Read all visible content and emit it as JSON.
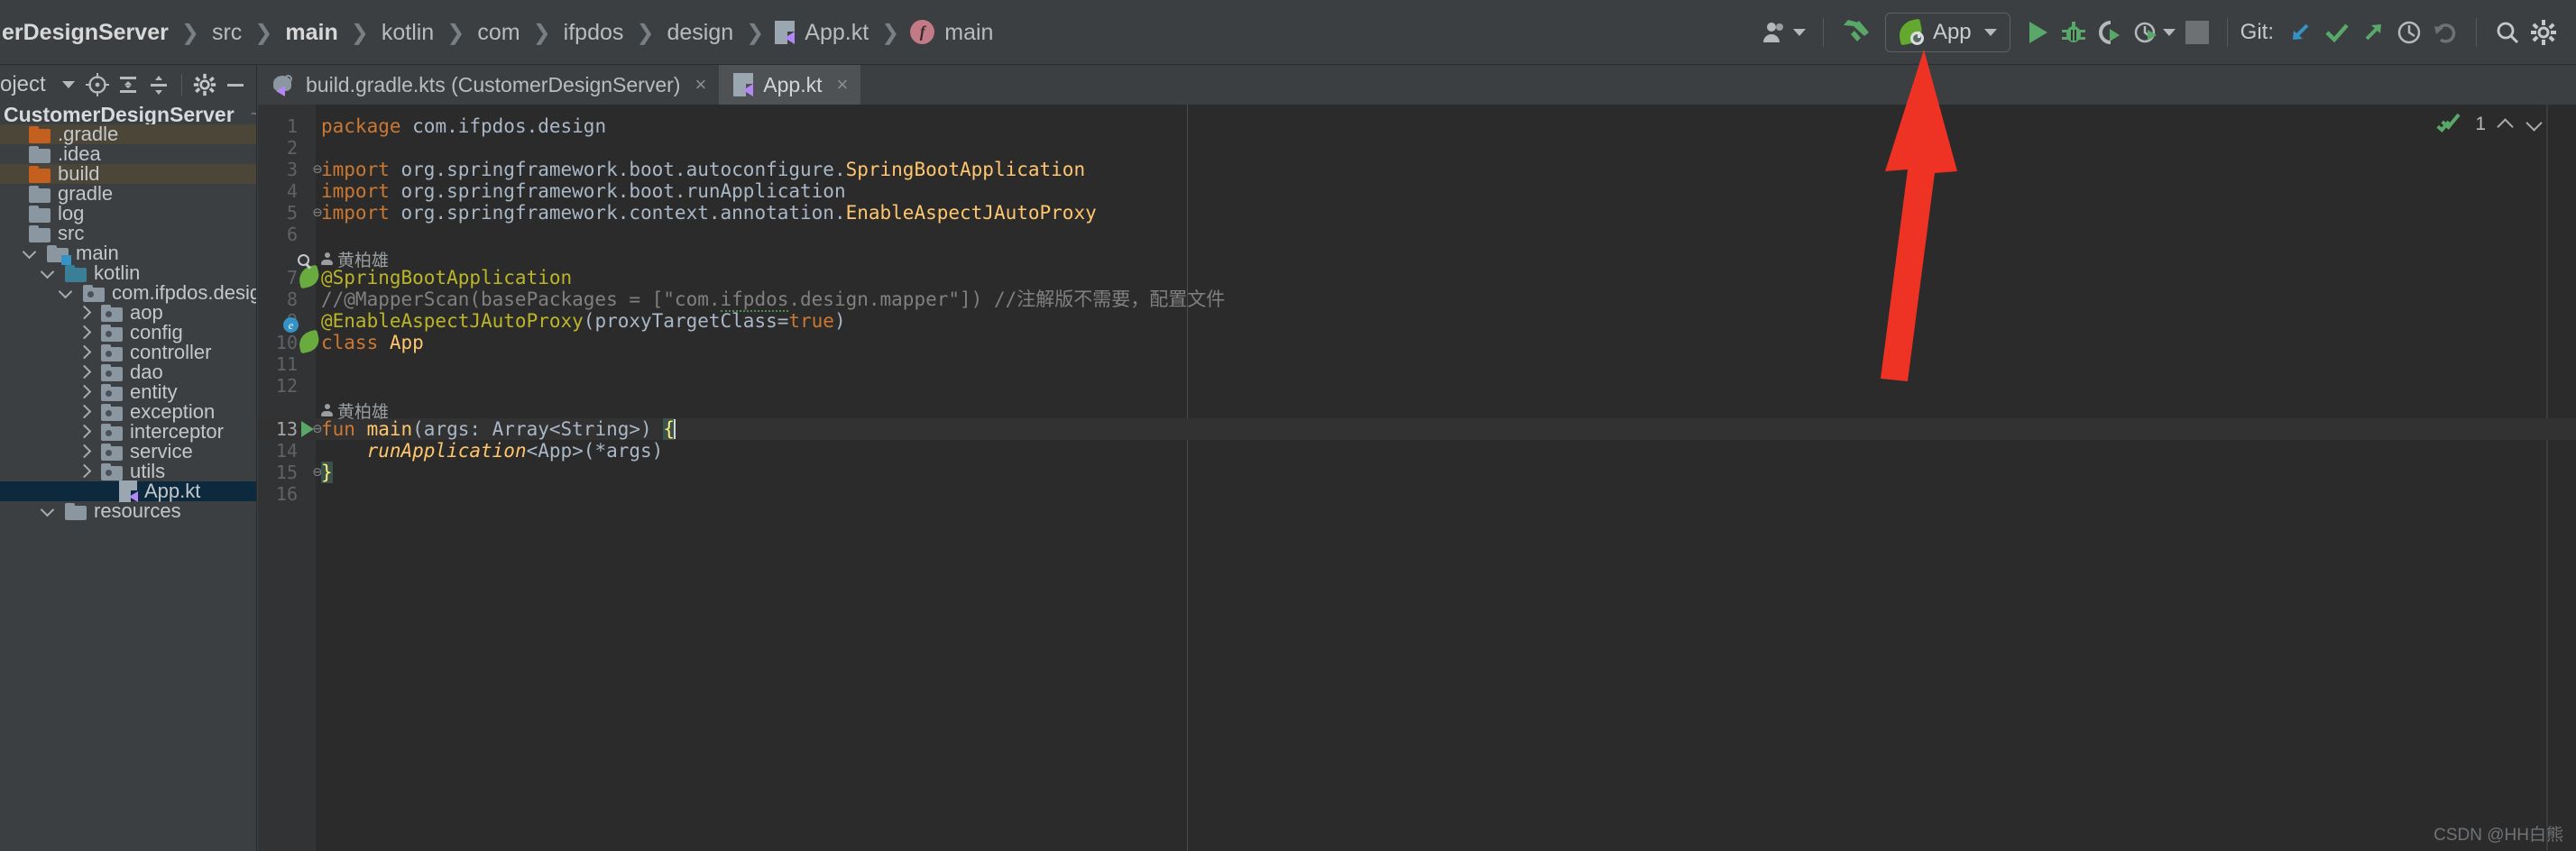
{
  "navbar": {
    "breadcrumbs": [
      {
        "label": "erDesignServer",
        "bold": true,
        "icon": null
      },
      {
        "label": "src",
        "bold": false,
        "icon": null
      },
      {
        "label": "main",
        "bold": true,
        "icon": null
      },
      {
        "label": "kotlin",
        "bold": false,
        "icon": null
      },
      {
        "label": "com",
        "bold": false,
        "icon": null
      },
      {
        "label": "ifpdos",
        "bold": false,
        "icon": null
      },
      {
        "label": "design",
        "bold": false,
        "icon": null
      },
      {
        "label": "App.kt",
        "bold": false,
        "icon": "kotlin-file-icon"
      },
      {
        "label": "main",
        "bold": false,
        "icon": "function-badge-icon"
      }
    ],
    "separator": "❯",
    "run_config": {
      "name": "App",
      "icon": "spring-boot-icon",
      "dropdown": "▼"
    },
    "buttons": {
      "profile": "profile-icon",
      "build": "hammer-icon",
      "run": "run-icon",
      "debug": "debug-icon",
      "run_coverage": "run-with-coverage-icon",
      "profiler": "profiler-icon",
      "more": "chevron-down-icon",
      "stop": "stop-icon",
      "search": "search-icon",
      "settings": "gear-icon"
    },
    "git": {
      "label": "Git:",
      "update": "update-project-icon",
      "commit": "commit-icon",
      "push": "push-icon",
      "history": "history-icon",
      "rollback": "rollback-icon"
    }
  },
  "project_panel": {
    "title": "roject",
    "dropdown": "▼",
    "toolbar": [
      "locate-icon",
      "expand-all-icon",
      "collapse-all-icon",
      "settings-icon",
      "hide-icon"
    ],
    "tree": [
      {
        "label": "CustomerDesignServer",
        "path": "~/WebProject/C",
        "indent": 0,
        "chevron": "none",
        "icon": "none",
        "style": "root"
      },
      {
        "label": ".gradle",
        "indent": 0,
        "chevron": "none",
        "icon": "folder-orange",
        "style": "excluded"
      },
      {
        "label": ".idea",
        "indent": 0,
        "chevron": "none",
        "icon": "folder",
        "style": "normal"
      },
      {
        "label": "build",
        "indent": 0,
        "chevron": "none",
        "icon": "folder-orange",
        "style": "excluded"
      },
      {
        "label": "gradle",
        "indent": 0,
        "chevron": "none",
        "icon": "folder",
        "style": "normal"
      },
      {
        "label": "log",
        "indent": 0,
        "chevron": "none",
        "icon": "folder",
        "style": "normal"
      },
      {
        "label": "src",
        "indent": 0,
        "chevron": "none",
        "icon": "folder",
        "style": "normal"
      },
      {
        "label": "main",
        "indent": 1,
        "chevron": "down",
        "icon": "folder-module",
        "style": "bold"
      },
      {
        "label": "kotlin",
        "indent": 2,
        "chevron": "down",
        "icon": "folder-teal",
        "style": "normal"
      },
      {
        "label": "com.ifpdos.design",
        "indent": 3,
        "chevron": "down",
        "icon": "folder-package",
        "style": "normal"
      },
      {
        "label": "aop",
        "indent": 4,
        "chevron": "right",
        "icon": "folder-package",
        "style": "normal"
      },
      {
        "label": "config",
        "indent": 4,
        "chevron": "right",
        "icon": "folder-package",
        "style": "normal"
      },
      {
        "label": "controller",
        "indent": 4,
        "chevron": "right",
        "icon": "folder-package",
        "style": "normal"
      },
      {
        "label": "dao",
        "indent": 4,
        "chevron": "right",
        "icon": "folder-package",
        "style": "normal"
      },
      {
        "label": "entity",
        "indent": 4,
        "chevron": "right",
        "icon": "folder-package",
        "style": "normal"
      },
      {
        "label": "exception",
        "indent": 4,
        "chevron": "right",
        "icon": "folder-package",
        "style": "normal"
      },
      {
        "label": "interceptor",
        "indent": 4,
        "chevron": "right",
        "icon": "folder-package",
        "style": "normal"
      },
      {
        "label": "service",
        "indent": 4,
        "chevron": "right",
        "icon": "folder-package",
        "style": "normal"
      },
      {
        "label": "utils",
        "indent": 4,
        "chevron": "right",
        "icon": "folder-package",
        "style": "normal"
      },
      {
        "label": "App.kt",
        "indent": 5,
        "chevron": "none",
        "icon": "kotlin-file",
        "style": "selected"
      },
      {
        "label": "resources",
        "indent": 2,
        "chevron": "down",
        "icon": "folder",
        "style": "normal"
      }
    ]
  },
  "editor": {
    "tabs": [
      {
        "label": "build.gradle.kts (CustomerDesignServer)",
        "icon": "gradle-icon",
        "active": false,
        "close": "×"
      },
      {
        "label": "App.kt",
        "icon": "kotlin-file-icon",
        "active": true,
        "close": "×"
      }
    ],
    "inspection": {
      "count": "1",
      "icon": "inspection-ok-icon",
      "prev": "chevron-up-icon",
      "next": "chevron-down-icon"
    },
    "annotations": [
      {
        "line": 7,
        "author": "黄柏雄"
      },
      {
        "line": 13,
        "author": "黄柏雄"
      }
    ],
    "lines": [
      {
        "n": 1,
        "fold": "",
        "gutter": "",
        "current": false
      },
      {
        "n": 2,
        "fold": "",
        "gutter": "",
        "current": false
      },
      {
        "n": 3,
        "fold": "minus",
        "gutter": "",
        "current": false
      },
      {
        "n": 4,
        "fold": "",
        "gutter": "",
        "current": false
      },
      {
        "n": 5,
        "fold": "end",
        "gutter": "",
        "current": false
      },
      {
        "n": 6,
        "fold": "",
        "gutter": "",
        "current": false
      },
      {
        "n": 7,
        "fold": "",
        "gutter": "spring-bean-search",
        "current": false
      },
      {
        "n": 8,
        "fold": "",
        "gutter": "",
        "current": false
      },
      {
        "n": 9,
        "fold": "",
        "gutter": "",
        "current": false
      },
      {
        "n": 10,
        "fold": "",
        "gutter": "spring-bean",
        "current": false
      },
      {
        "n": 11,
        "fold": "",
        "gutter": "",
        "current": false
      },
      {
        "n": 12,
        "fold": "",
        "gutter": "",
        "current": false
      },
      {
        "n": 13,
        "fold": "minus",
        "gutter": "run",
        "current": true
      },
      {
        "n": 14,
        "fold": "",
        "gutter": "",
        "current": false
      },
      {
        "n": 15,
        "fold": "end",
        "gutter": "",
        "current": false
      },
      {
        "n": 16,
        "fold": "",
        "gutter": "",
        "current": false
      }
    ],
    "code": {
      "l1": "package com.ifpdos.design",
      "l3_kw": "import",
      "l3_id": " org.springframework.boot.autoconfigure.",
      "l3_cls": "SpringBootApplication",
      "l4_kw": "import",
      "l4_id": " org.springframework.boot.runApplication",
      "l5_kw": "import",
      "l5_id": " org.springframework.context.annotation.",
      "l5_cls": "EnableAspectJAutoProxy",
      "l7": "@SpringBootApplication",
      "l8_a": "//@MapperScan(basePackages = [\"com.",
      "l8_b": "ifpdos",
      "l8_c": ".design.mapper\"]) //注解版不需要，配置文件",
      "l9_ann": "@EnableAspectJAutoProxy",
      "l9_p1": "(proxyTargetClass=",
      "l9_true": "true",
      "l9_p2": ")",
      "l10_kw": "class",
      "l10_cls": " App",
      "l13_kw": "fun",
      "l13_name": " main",
      "l13_sig": "(args: Array<String>) ",
      "l13_brace": "{",
      "l14_fn": "runApplication",
      "l14_rest": "<App>(*args)",
      "l15_brace": "}"
    }
  },
  "watermark": "CSDN @HH白熊",
  "colors": {
    "accent_green": "#59a869",
    "accent_orange": "#cc7832",
    "accent_yellow": "#ffc66d",
    "annotation": "#bbb529",
    "selection": "#0d293e",
    "excluded_row": "#4c4639",
    "arrow_red": "#ee3224"
  }
}
